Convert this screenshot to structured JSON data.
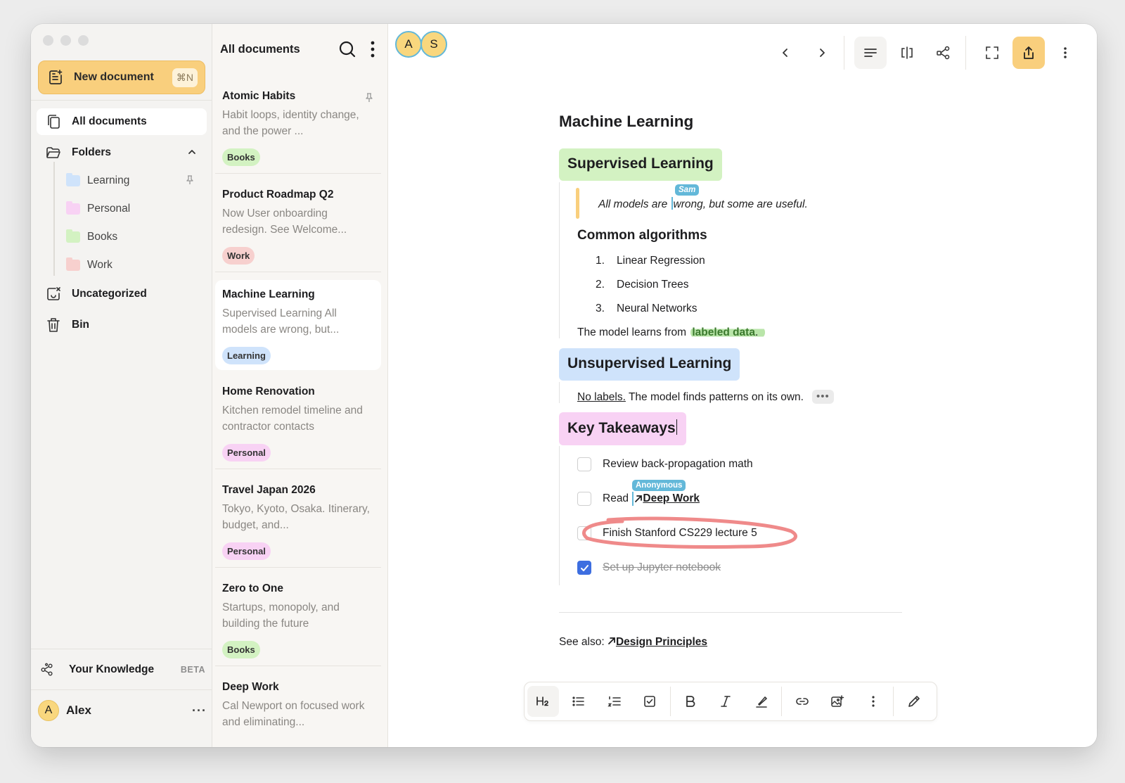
{
  "sidebar": {
    "new_document": {
      "label": "New document",
      "shortcut": "⌘N",
      "icon": "new-document-icon"
    },
    "all_documents": "All documents",
    "folders_label": "Folders",
    "folders": [
      {
        "name": "Learning",
        "color": "#cfe3fb",
        "pinned": true
      },
      {
        "name": "Personal",
        "color": "#f8d2f4"
      },
      {
        "name": "Books",
        "color": "#d3f2c2"
      },
      {
        "name": "Work",
        "color": "#f7d0ce"
      }
    ],
    "uncategorized": "Uncategorized",
    "bin": "Bin",
    "knowledge": {
      "label": "Your Knowledge",
      "badge": "BETA"
    },
    "user": {
      "initial": "A",
      "name": "Alex",
      "more": "···"
    }
  },
  "list": {
    "title": "All documents",
    "cards": [
      {
        "title": "Atomic Habits",
        "snippet": "Habit loops, identity change, and the power ...",
        "tag": "Books",
        "tag_color": "#d3f2c2",
        "pinned": true
      },
      {
        "title": "Product Roadmap Q2",
        "snippet": "Now User onboarding redesign. See Welcome...",
        "tag": "Work",
        "tag_color": "#f7d0ce"
      },
      {
        "title": "Machine Learning",
        "snippet": "Supervised Learning All models are wrong, but...",
        "tag": "Learning",
        "tag_color": "#cfe3fb",
        "active": true
      },
      {
        "title": "Home Renovation",
        "snippet": "Kitchen remodel timeline and contractor contacts",
        "tag": "Personal",
        "tag_color": "#f8d2f4"
      },
      {
        "title": "Travel Japan 2026",
        "snippet": "Tokyo, Kyoto, Osaka. Itinerary, budget, and...",
        "tag": "Personal",
        "tag_color": "#f8d2f4"
      },
      {
        "title": "Zero to One",
        "snippet": "Startups, monopoly, and building the future",
        "tag": "Books",
        "tag_color": "#d3f2c2"
      },
      {
        "title": "Deep Work",
        "snippet": "Cal Newport on focused work and eliminating...",
        "tag": "",
        "tag_color": ""
      }
    ]
  },
  "collaborators": [
    "A",
    "S"
  ],
  "doc": {
    "title": "Machine Learning",
    "h2_supervised": "Supervised Learning",
    "quote_before": "All models are ",
    "quote_after": "wrong, but some are useful.",
    "cursor_sam": "Sam",
    "common_algorithms": "Common algorithms",
    "algorithms": [
      {
        "n": "1.",
        "text": "Linear Regression"
      },
      {
        "n": "2.",
        "text": "Decision Trees"
      },
      {
        "n": "3.",
        "text": "Neural Networks"
      }
    ],
    "learns_prefix": "The model learns from ",
    "learns_highlight": "labeled data",
    "learns_suffix": ".",
    "h2_unsupervised": "Unsupervised Learning",
    "nolabels_link": "No labels.",
    "nolabels_rest": " The model finds patterns on its own.",
    "more_dots": "•••",
    "h2_takeaways": "Key Takeaways",
    "tasks": {
      "t1": "Review back-propagation math",
      "t2_prefix": "Read ",
      "t2_link": "Deep Work",
      "t2_cursor": "Anonymous",
      "t3": "Finish Stanford CS229 lecture 5",
      "t4": "Set up Jupyter notebook"
    },
    "see_also_prefix": "See also: ",
    "see_also_link": "Design Principles"
  },
  "colors": {
    "accent": "#f9cf7d",
    "collab_cursor": "#63b8d9",
    "h2_supervised_bg": "#d3f2c2",
    "h2_unsupervised_bg": "#cfe3fb",
    "h2_takeaways_bg": "#f8d2f4",
    "annotation_circle": "#ef8a8a",
    "checkbox_on": "#3d6ee0"
  }
}
